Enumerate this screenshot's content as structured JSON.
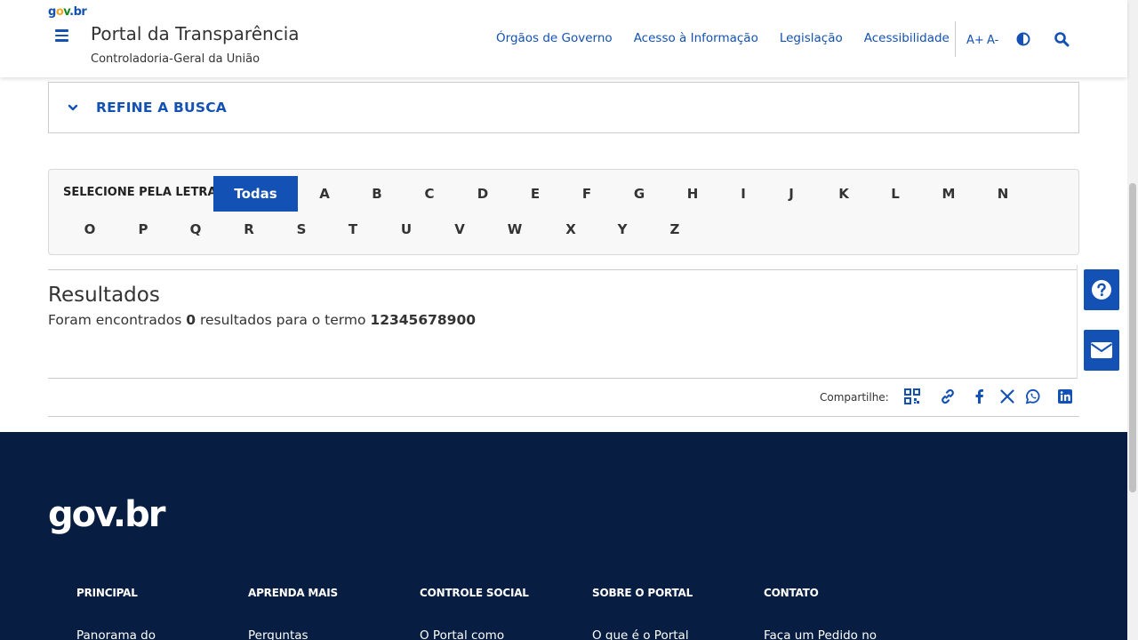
{
  "header": {
    "logo": {
      "g": "g",
      "o": "o",
      "v": "v",
      "b": ".br"
    },
    "title": "Portal da Transparência",
    "subtitle": "Controladoria-Geral da União",
    "nav": [
      "Órgãos de Governo",
      "Acesso à Informação",
      "Legislação",
      "Acessibilidade"
    ],
    "font_increase": "A+",
    "font_decrease": "A-"
  },
  "refine": {
    "label": "REFINE A BUSCA"
  },
  "letter_selector": {
    "label": "SELECIONE PELA LETRA:",
    "active": "Todas",
    "row1": [
      "Todas",
      "A",
      "B",
      "C",
      "D",
      "E",
      "F",
      "G",
      "H",
      "I",
      "J",
      "K",
      "L",
      "M",
      "N"
    ],
    "row2": [
      "O",
      "P",
      "Q",
      "R",
      "S",
      "T",
      "U",
      "V",
      "W",
      "X",
      "Y",
      "Z"
    ]
  },
  "results": {
    "title": "Resultados",
    "prefix": "Foram encontrados",
    "count": "0",
    "middle": "resultados para o termo",
    "term": "12345678900"
  },
  "share": {
    "label": "Compartilhe:",
    "icons": [
      "qrcode-icon",
      "link-icon",
      "facebook-icon",
      "x-icon",
      "whatsapp-icon",
      "linkedin-icon"
    ]
  },
  "footer": {
    "logo": "gov.br",
    "columns": [
      {
        "head": "PRINCIPAL",
        "first_link": "Panorama do"
      },
      {
        "head": "APRENDA MAIS",
        "first_link": "Perguntas"
      },
      {
        "head": "CONTROLE SOCIAL",
        "first_link": "O Portal como"
      },
      {
        "head": "SOBRE O PORTAL",
        "first_link": "O que é o Portal"
      },
      {
        "head": "CONTATO",
        "first_link": "Faça um Pedido no"
      }
    ]
  },
  "colors": {
    "primary": "#1351b4",
    "footer_bg": "#071d41",
    "text": "#333333"
  }
}
